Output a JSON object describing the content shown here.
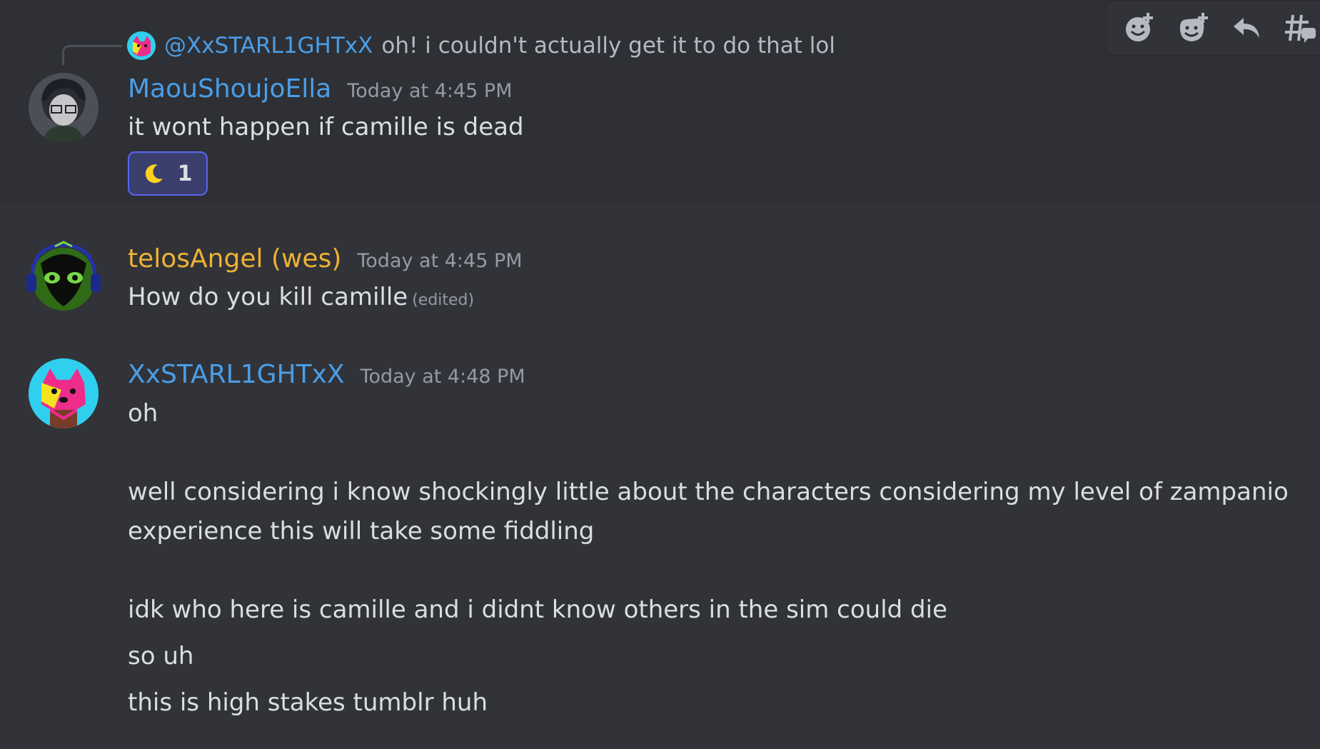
{
  "reply": {
    "mention": "@XxSTARL1GHTxX",
    "text": "oh! i couldn't actually get it to do that lol"
  },
  "messages": [
    {
      "username": "MaouShoujoElla",
      "timestamp": "Today at 4:45 PM",
      "lines": [
        "it wont happen if camille is dead"
      ],
      "reaction": {
        "emoji": "crescent-moon-icon",
        "count": "1"
      },
      "name_color": "#4a9ee8"
    },
    {
      "username": "telosAngel (wes)",
      "timestamp": "Today at 4:45 PM",
      "lines": [
        "How do you kill camille"
      ],
      "edited": "(edited)",
      "name_color": "#f0b232"
    },
    {
      "username": "XxSTARL1GHTxX",
      "timestamp": "Today at 4:48 PM",
      "lines": [
        "oh",
        "well considering i know shockingly little about the characters considering my level of zampanio",
        "experience this will take some fiddling",
        "idk who here is camille and i didnt know others in the sim could die",
        "so uh",
        "this is high stakes tumblr huh"
      ],
      "name_color": "#4a9ee8"
    }
  ],
  "toolbar": {
    "icons": [
      "add-reaction-icon",
      "add-super-reaction-icon",
      "reply-icon",
      "create-thread-icon"
    ]
  },
  "colors": {
    "background": "#313338",
    "text": "#dbdee1",
    "muted": "#949ba4",
    "reaction_border": "#5865f2"
  }
}
